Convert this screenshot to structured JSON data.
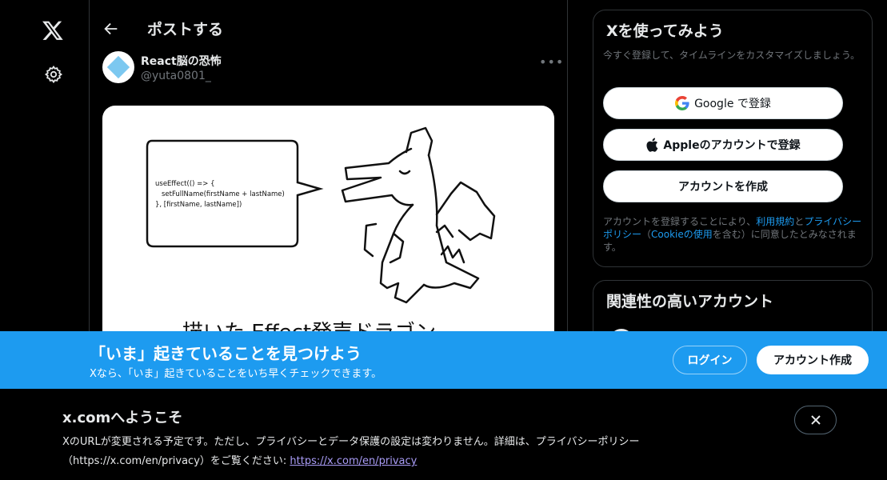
{
  "nav": {
    "logo_icon": "x-logo-icon",
    "settings_icon": "gear-icon"
  },
  "post": {
    "back_icon": "arrow-left-icon",
    "page_title": "ポストする",
    "user_name": "React脳の恐怖",
    "user_handle": "@yuta0801_",
    "more_label": "•••",
    "image": {
      "code_line1": "useEffect(() => {",
      "code_line2": "setFullName(firstName + lastName)",
      "code_line3": "}, [firstName, lastName])",
      "caption": "描いた  Effect発声ドラゴン"
    }
  },
  "signup": {
    "title": "Xを使ってみよう",
    "subtitle": "今すぐ登録して、タイムラインをカスタマイズしましょう。",
    "google_label": "Google で登録",
    "apple_label": "Appleのアカウントで登録",
    "create_label": "アカウントを作成",
    "terms_before": "アカウントを登録することにより、",
    "terms_link": "利用規約",
    "terms_and": "と",
    "privacy_link": "プライバシーポリシー",
    "terms_paren_open": "（",
    "cookie_link": "Cookieの使用",
    "terms_after": "を含む）に同意したとみなされます。"
  },
  "related": {
    "title": "関連性の高いアカウント"
  },
  "banner": {
    "heading": "「いま」起きていることを見つけよう",
    "subheading": "Xなら、「いま」起きていることをいち早くチェックできます。",
    "login_label": "ログイン",
    "create_label": "アカウント作成"
  },
  "notice": {
    "title": "x.comへようこそ",
    "text": "XのURLが変更される予定です。ただし、プライバシーとデータ保護の設定は変わりません。詳細は、プライバシーポリシー（https://x.com/en/privacy）をご覧ください: ",
    "link": "https://x.com/en/privacy",
    "close_icon": "close-icon"
  },
  "colors": {
    "accent": "#1d9bf0",
    "background": "#000000",
    "border": "#2f3336"
  }
}
